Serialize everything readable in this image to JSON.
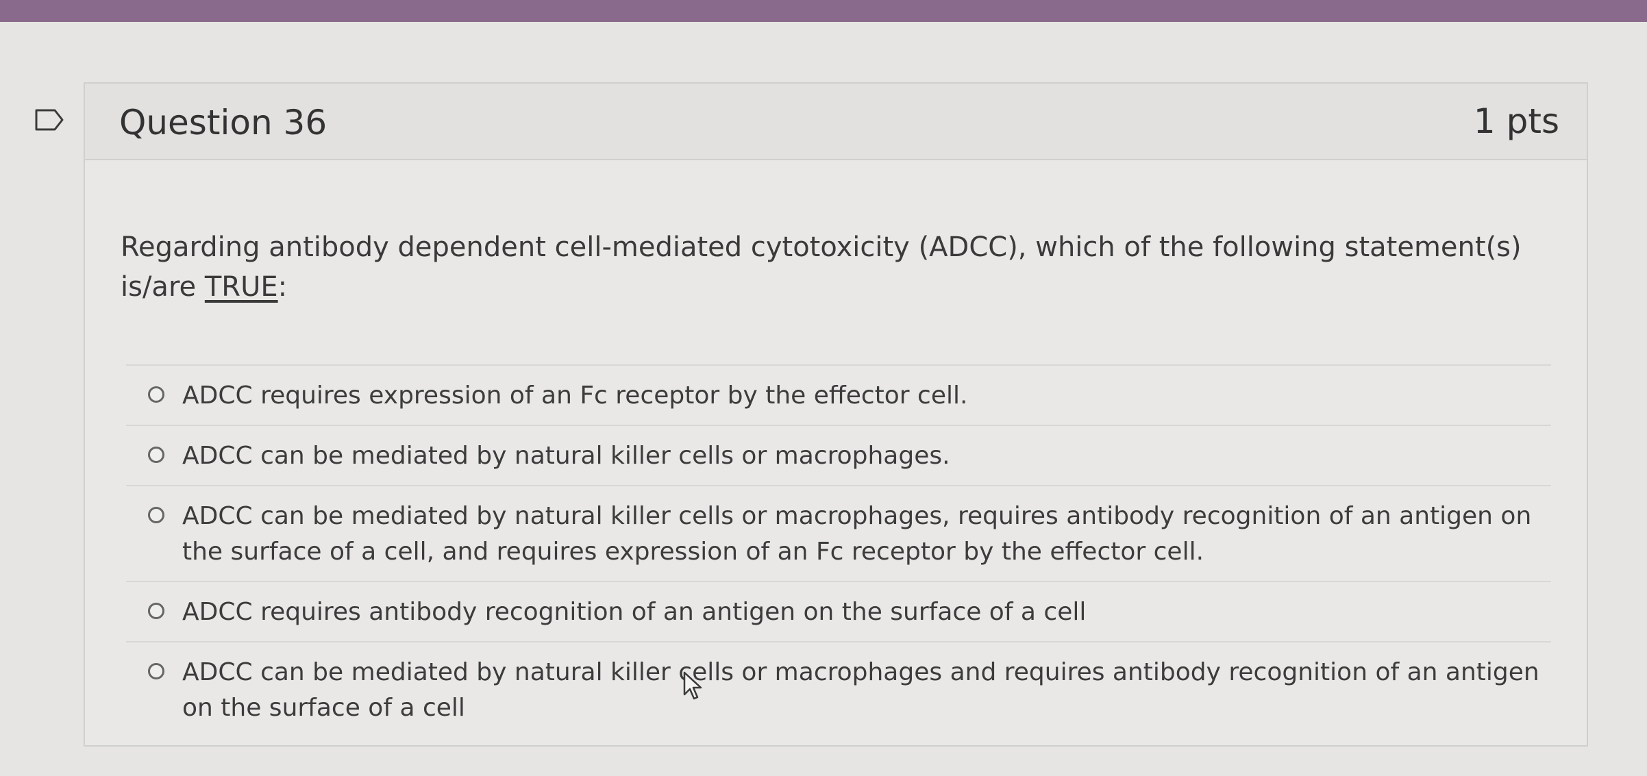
{
  "question": {
    "title": "Question 36",
    "points": "1 pts",
    "text_prefix": "Regarding antibody dependent cell-mediated cytotoxicity (ADCC), which of the following statement(s) is/are ",
    "text_emphasis": "TRUE",
    "text_suffix": ":"
  },
  "answers": [
    {
      "label": "ADCC requires expression of an Fc receptor by the effector cell."
    },
    {
      "label": "ADCC can be mediated by natural killer cells or macrophages."
    },
    {
      "label": "ADCC can be mediated by natural killer cells or macrophages, requires antibody recognition of an antigen on the surface of a cell, and requires expression of an Fc receptor by the effector cell."
    },
    {
      "label": "ADCC requires antibody recognition of an antigen on the surface of a cell"
    },
    {
      "label": "ADCC can be mediated by natural killer cells or macrophages and requires antibody recognition of an antigen on the surface of a cell"
    }
  ],
  "icons": {
    "flag": "flag-icon",
    "cursor": "mouse-pointer-icon"
  },
  "colors": {
    "top_band": "#8a6a8c",
    "background": "#e6e5e3",
    "text": "#3a3a3a"
  }
}
